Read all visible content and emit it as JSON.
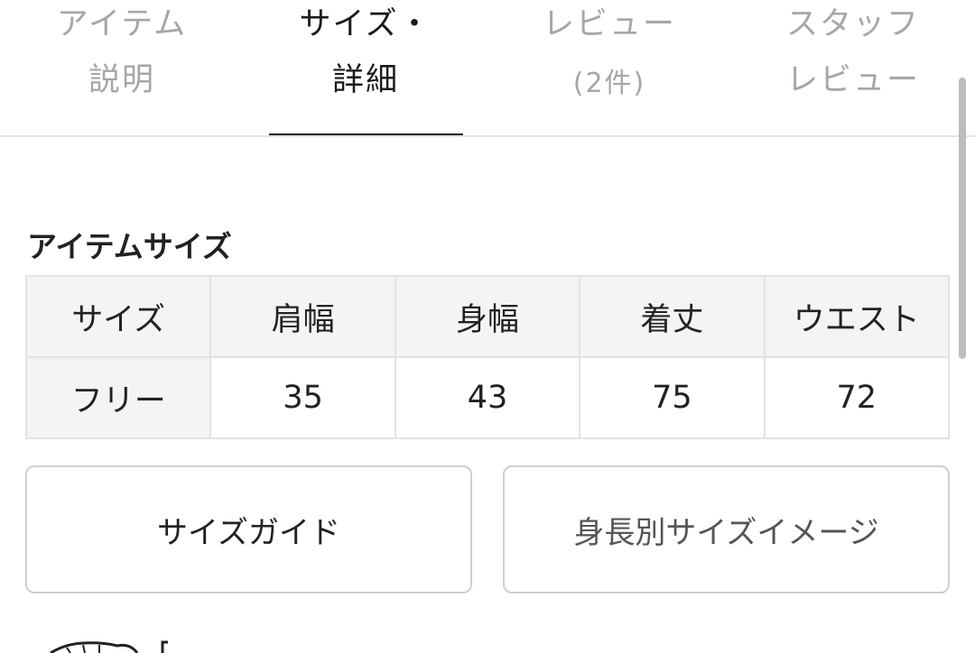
{
  "tabs": [
    {
      "line1": "アイテム",
      "line2": "説明",
      "active": false
    },
    {
      "line1": "サイズ・",
      "line2": "詳細",
      "active": true
    },
    {
      "line1": "レビュー",
      "line2": "(2件)",
      "active": false
    },
    {
      "line1": "スタッフ",
      "line2": "レビュー",
      "active": false
    }
  ],
  "section": {
    "title": "アイテムサイズ"
  },
  "size_table": {
    "headers": [
      "サイズ",
      "肩幅",
      "身幅",
      "着丈",
      "ウエスト"
    ],
    "rows": [
      {
        "size": "フリー",
        "values": [
          "35",
          "43",
          "75",
          "72"
        ]
      }
    ]
  },
  "buttons": {
    "size_guide": "サイズガイド",
    "height_size_image": "身長別サイズイメージ"
  },
  "colors": {
    "active_text": "#1a1a1a",
    "inactive_text": "#a6a6a6",
    "header_bg": "#f4f4f4",
    "border": "#e2e2e2"
  }
}
